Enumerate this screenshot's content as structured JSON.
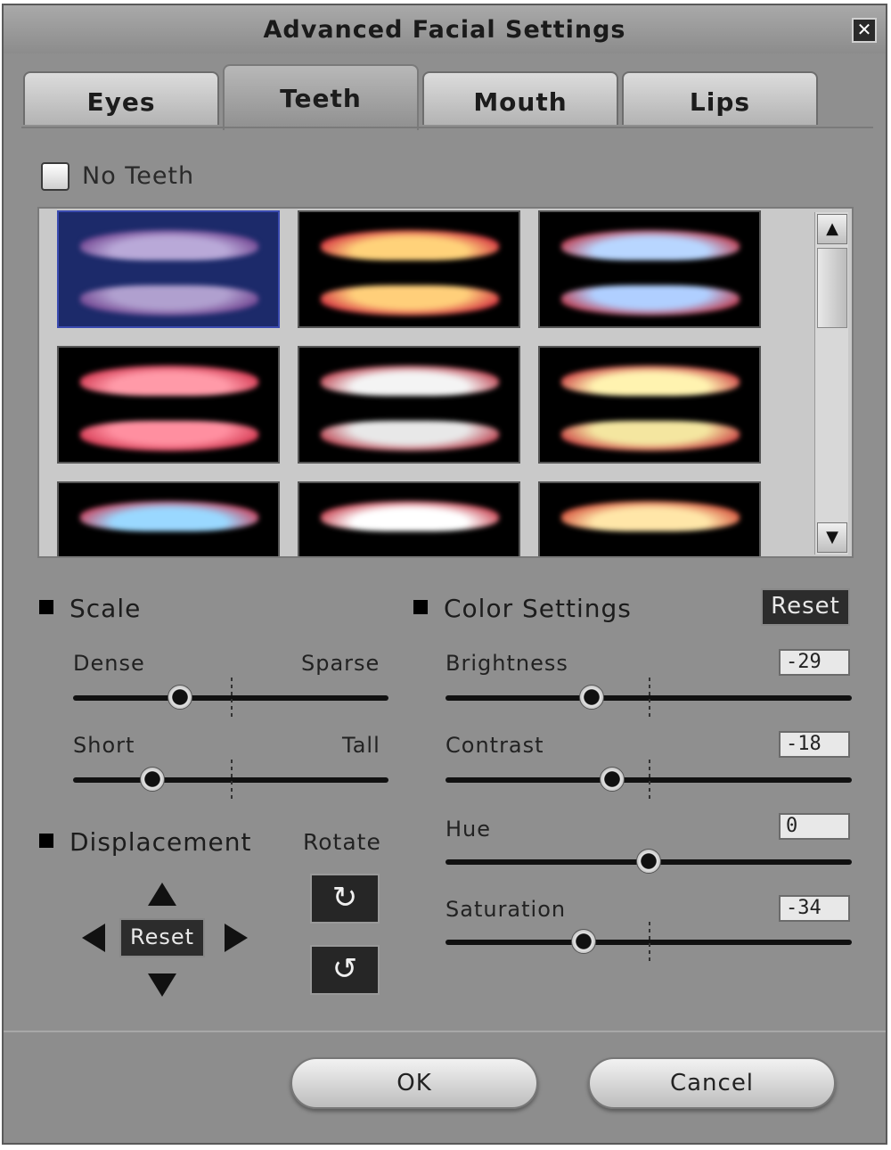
{
  "window": {
    "title": "Advanced Facial Settings",
    "close_label": "✕"
  },
  "tabs": [
    {
      "label": "Eyes",
      "active": false
    },
    {
      "label": "Teeth",
      "active": true
    },
    {
      "label": "Mouth",
      "active": false
    },
    {
      "label": "Lips",
      "active": false
    }
  ],
  "no_teeth": {
    "label": "No Teeth",
    "checked": false
  },
  "gallery": {
    "selected_index": 0,
    "thumbnails": [
      {
        "upper": "#b9a9d8",
        "lower": "#b0a0cf",
        "gum": "#6a3a8a"
      },
      {
        "upper": "#ffd27a",
        "lower": "#ffcf7a",
        "gum": "#d0203a"
      },
      {
        "upper": "#b8d6ff",
        "lower": "#b0cfff",
        "gum": "#c02a3a"
      },
      {
        "upper": "#ff9aa8",
        "lower": "#ff8fa0",
        "gum": "#d0304a"
      },
      {
        "upper": "#f4f4f4",
        "lower": "#e8e8e8",
        "gum": "#b8303f"
      },
      {
        "upper": "#fff3b0",
        "lower": "#f4e6a0",
        "gum": "#c8303a"
      },
      {
        "upper": "#9ad8ff",
        "lower": "#000000",
        "gum": "#d0304a"
      },
      {
        "upper": "#ffffff",
        "lower": "#000000",
        "gum": "#c02a3a"
      },
      {
        "upper": "#ffe6a8",
        "lower": "#000000",
        "gum": "#d04030"
      }
    ]
  },
  "scale": {
    "heading": "Scale",
    "dense_label": "Dense",
    "sparse_label": "Sparse",
    "dense_sparse_value": 0.34,
    "short_label": "Short",
    "tall_label": "Tall",
    "short_tall_value": 0.25
  },
  "displacement": {
    "heading": "Displacement",
    "rotate_label": "Rotate",
    "reset_label": "Reset"
  },
  "color_settings": {
    "heading": "Color Settings",
    "reset_label": "Reset",
    "brightness": {
      "label": "Brightness",
      "value": "-29",
      "level": 0.36
    },
    "contrast": {
      "label": "Contrast",
      "value": "-18",
      "level": 0.41
    },
    "hue": {
      "label": "Hue",
      "value": "0",
      "level": 0.5
    },
    "saturation": {
      "label": "Saturation",
      "value": "-34",
      "level": 0.34
    }
  },
  "footer": {
    "ok_label": "OK",
    "cancel_label": "Cancel"
  }
}
